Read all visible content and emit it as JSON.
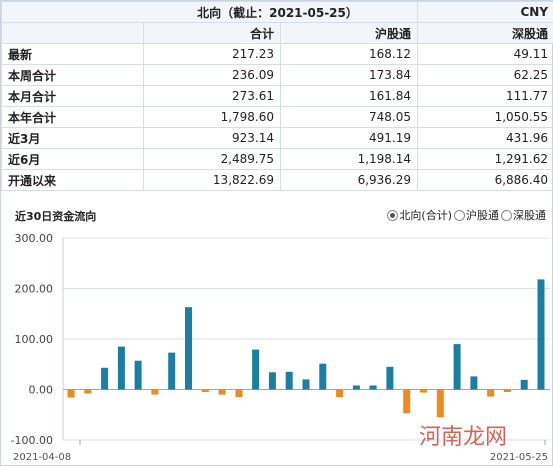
{
  "table": {
    "title": "北向（截止：2021-05-25）",
    "currency": "CNY",
    "columns": [
      "合计",
      "沪股通",
      "深股通"
    ],
    "rows": [
      {
        "label": "最新",
        "values": [
          "217.23",
          "168.12",
          "49.11"
        ]
      },
      {
        "label": "本周合计",
        "values": [
          "236.09",
          "173.84",
          "62.25"
        ]
      },
      {
        "label": "本月合计",
        "values": [
          "273.61",
          "161.84",
          "111.77"
        ]
      },
      {
        "label": "本年合计",
        "values": [
          "1,798.60",
          "748.05",
          "1,050.55"
        ]
      },
      {
        "label": "近3月",
        "values": [
          "923.14",
          "491.19",
          "431.96"
        ]
      },
      {
        "label": "近6月",
        "values": [
          "2,489.75",
          "1,198.14",
          "1,291.62"
        ]
      },
      {
        "label": "开通以来",
        "values": [
          "13,822.69",
          "6,936.29",
          "6,886.40"
        ]
      }
    ]
  },
  "chart_header": {
    "title": "近30日资金流向",
    "options": [
      {
        "label": "北向(合计)",
        "selected": true
      },
      {
        "label": "沪股通",
        "selected": false
      },
      {
        "label": "深股通",
        "selected": false
      }
    ]
  },
  "chart_data": {
    "type": "bar",
    "title": "近30日资金流向",
    "ylim": [
      -100,
      300
    ],
    "yticks": [
      "300.00",
      "200.00",
      "100.00",
      "0.00",
      "-100.00"
    ],
    "ytick_values": [
      300,
      200,
      100,
      0,
      -100
    ],
    "x_start_label": "2021-04-08",
    "x_end_label": "2021-05-25",
    "positive_color": "#1a7fa3",
    "negative_color": "#f08a1d",
    "values": [
      -16,
      -8,
      43,
      85,
      57,
      -10,
      73,
      163,
      -5,
      -10,
      -15,
      79,
      34,
      35,
      20,
      51,
      -15,
      8,
      8,
      45,
      -47,
      -6,
      -55,
      90,
      26,
      -14,
      -5,
      19,
      218
    ]
  },
  "watermark": "河南龙网"
}
